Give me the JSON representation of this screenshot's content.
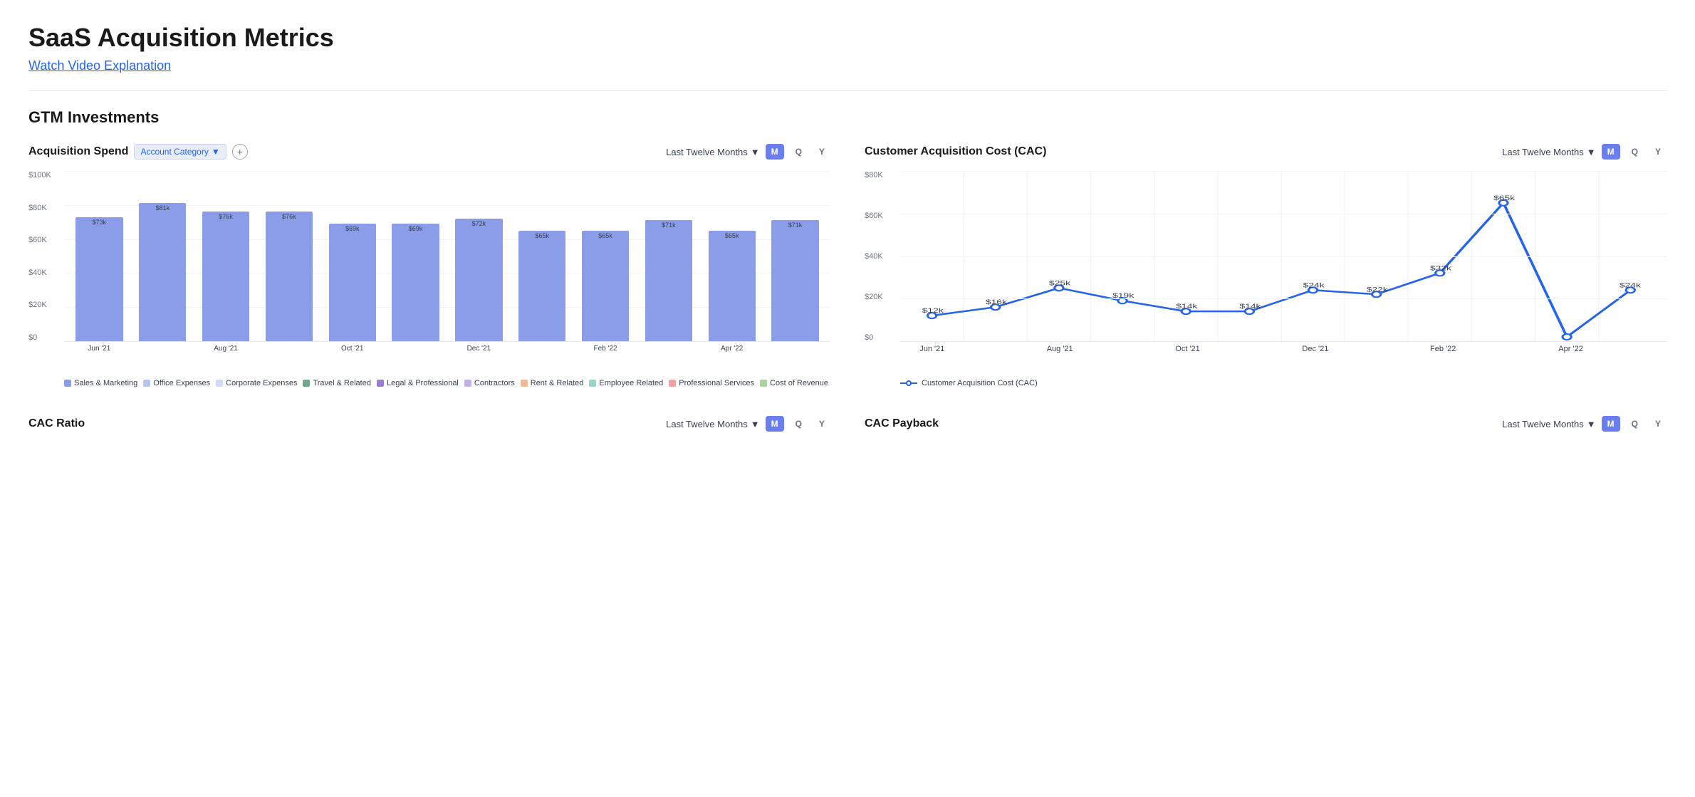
{
  "page": {
    "title": "SaaS Acquisition Metrics",
    "video_link": "Watch Video Explanation",
    "section_title": "GTM Investments"
  },
  "acquisition_spend": {
    "title": "Acquisition Spend",
    "filter_label": "Account Category",
    "period": "Last Twelve Months",
    "active_period": "M",
    "periods": [
      "M",
      "Q",
      "Y"
    ],
    "y_axis": [
      "$100K",
      "$80K",
      "$60K",
      "$40K",
      "$20K",
      "$0"
    ],
    "bars": [
      {
        "label": "Jun '21",
        "value": 73,
        "display": "$73k"
      },
      {
        "label": "Aug '21",
        "value": 81,
        "display": "$81k"
      },
      {
        "label": "Oct '21",
        "value": 76,
        "display": "$76k"
      },
      {
        "label": "",
        "value": 76,
        "display": "$76k"
      },
      {
        "label": "Oct '21",
        "value": 69,
        "display": "$69k"
      },
      {
        "label": "",
        "value": 69,
        "display": "$69k"
      },
      {
        "label": "Dec '21",
        "value": 72,
        "display": "$72k"
      },
      {
        "label": "",
        "value": 65,
        "display": "$65k"
      },
      {
        "label": "Feb '22",
        "value": 65,
        "display": "$65k"
      },
      {
        "label": "",
        "value": 71,
        "display": "$71k"
      },
      {
        "label": "Apr '22",
        "value": 65,
        "display": "$65k"
      },
      {
        "label": "",
        "value": 71,
        "display": "$71k"
      }
    ],
    "x_labels": [
      "Jun '21",
      "",
      "Aug '21",
      "",
      "Oct '21",
      "",
      "Dec '21",
      "",
      "Feb '22",
      "",
      "Apr '22",
      ""
    ],
    "legend": [
      {
        "label": "Sales & Marketing",
        "color": "#8b9de8"
      },
      {
        "label": "Office Expenses",
        "color": "#b8c4f0"
      },
      {
        "label": "Corporate Expenses",
        "color": "#d1d9f8"
      },
      {
        "label": "Travel & Related",
        "color": "#6aab8a"
      },
      {
        "label": "Legal & Professional",
        "color": "#9b7ed4"
      },
      {
        "label": "Contractors",
        "color": "#c4b0e8"
      },
      {
        "label": "Rent & Related",
        "color": "#f4b896"
      },
      {
        "label": "Employee Related",
        "color": "#98d4c8"
      },
      {
        "label": "Professional Services",
        "color": "#f4a0a0"
      },
      {
        "label": "Cost of Revenue",
        "color": "#a8d4a0"
      }
    ]
  },
  "cac": {
    "title": "Customer Acquisition Cost (CAC)",
    "period": "Last Twelve Months",
    "active_period": "M",
    "periods": [
      "M",
      "Q",
      "Y"
    ],
    "y_axis": [
      "$80K",
      "$60K",
      "$40K",
      "$20K",
      "$0"
    ],
    "points": [
      {
        "x": 0,
        "y": 12,
        "label": "$12k",
        "x_label": "Jun '21"
      },
      {
        "x": 1,
        "y": 16,
        "label": "$16k",
        "x_label": ""
      },
      {
        "x": 2,
        "y": 25,
        "label": "$25k",
        "x_label": "Aug '21"
      },
      {
        "x": 3,
        "y": 19,
        "label": "$19k",
        "x_label": ""
      },
      {
        "x": 4,
        "y": 14,
        "label": "$14k",
        "x_label": "Oct '21"
      },
      {
        "x": 5,
        "y": 14,
        "label": "$14k",
        "x_label": ""
      },
      {
        "x": 6,
        "y": 24,
        "label": "$24k",
        "x_label": "Dec '21"
      },
      {
        "x": 7,
        "y": 22,
        "label": "$22k",
        "x_label": ""
      },
      {
        "x": 8,
        "y": 32,
        "label": "$32k",
        "x_label": "Feb '22"
      },
      {
        "x": 9,
        "y": 65,
        "label": "$65k",
        "x_label": ""
      },
      {
        "x": 10,
        "y": 2,
        "label": "",
        "x_label": "Apr '22"
      },
      {
        "x": 11,
        "y": 24,
        "label": "$24k",
        "x_label": ""
      }
    ],
    "x_labels": [
      "Jun '21",
      "",
      "Aug '21",
      "",
      "Oct '21",
      "",
      "Dec '21",
      "",
      "Feb '22",
      "",
      "Apr '22",
      ""
    ],
    "legend_label": "Customer Acquisition Cost (CAC)"
  },
  "cac_ratio": {
    "title": "CAC Ratio",
    "period": "Last Twelve Months",
    "active_period": "M",
    "periods": [
      "M",
      "Q",
      "Y"
    ]
  },
  "cac_payback": {
    "title": "CAC Payback",
    "period": "Last Twelve Months",
    "active_period": "M",
    "periods": [
      "M",
      "Q",
      "Y"
    ]
  }
}
